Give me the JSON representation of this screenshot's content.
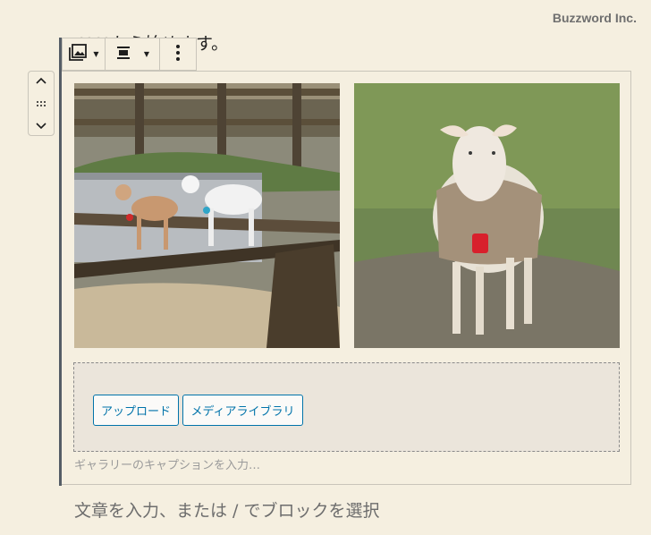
{
  "watermark": "Buzzword Inc.",
  "paragraph_above": "ここから始めます。",
  "toolbar": {
    "gallery_icon": "gallery-icon",
    "align_icon": "align-center-icon",
    "more_icon": "more-vertical-icon"
  },
  "block_mover": {
    "up_icon": "chevron-up-icon",
    "drag_icon": "drag-handle-icon",
    "down_icon": "chevron-down-icon"
  },
  "gallery": {
    "images": [
      {
        "name": "goats-on-fence-image",
        "alt": "goats on fence"
      },
      {
        "name": "sheep-in-coat-image",
        "alt": "sheep wearing a coat"
      }
    ],
    "upload_button": "アップロード",
    "media_library_button": "メディアライブラリ",
    "caption_placeholder": "ギャラリーのキャプションを入力…"
  },
  "appender_placeholder": "文章を入力、または / でブロックを選択",
  "colors": {
    "background": "#f5efe0",
    "accent": "#0073aa",
    "placeholder_bg": "#ebe5db"
  }
}
